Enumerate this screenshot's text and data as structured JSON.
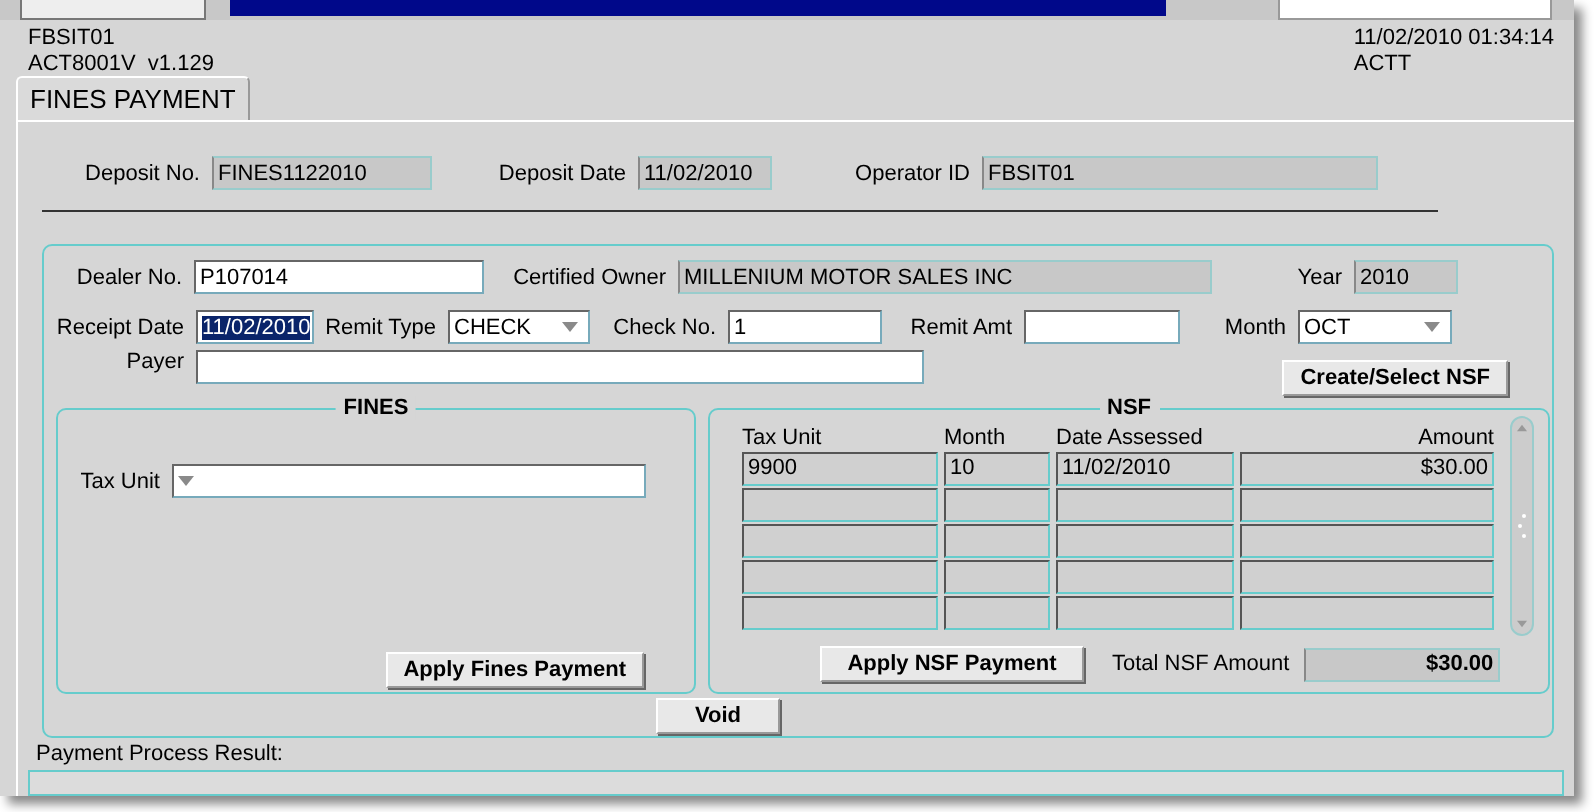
{
  "header": {
    "user": "FBSIT01",
    "version": "ACT8001V  v1.129",
    "datetime": "11/02/2010 01:34:14",
    "region": "ACTT"
  },
  "tabs": [
    {
      "label": "FINES PAYMENT",
      "selected": true
    }
  ],
  "deposit": [
    {
      "label": "Deposit No.",
      "value": "FINES1122010",
      "kind": "readonly"
    },
    {
      "label": "Deposit Date",
      "value": "11/02/2010",
      "kind": "readonly"
    },
    {
      "label": "Operator ID",
      "value": "FBSIT01",
      "kind": "readonly"
    }
  ],
  "form_rows": [
    [
      {
        "label": "Dealer No.",
        "value": "P107014",
        "kind": "text"
      },
      {
        "label": "Certified Owner",
        "value": "MILLENIUM MOTOR SALES INC",
        "kind": "readonly"
      },
      {
        "label": "Year",
        "value": "2010",
        "kind": "readonly"
      }
    ],
    [
      {
        "label": "Receipt Date",
        "value": "11/02/2010",
        "kind": "text",
        "selected": true
      },
      {
        "label": "Remit Type",
        "value": "CHECK",
        "kind": "select"
      },
      {
        "label": "Check No.",
        "value": "1",
        "kind": "text"
      },
      {
        "label": "Remit Amt",
        "kind": "text"
      },
      {
        "label": "Month",
        "value": "OCT",
        "kind": "select"
      }
    ],
    [
      {
        "label": "Payer",
        "kind": "text"
      }
    ]
  ],
  "create_nsf_button": "Create/Select NSF",
  "fines": {
    "title": "FINES",
    "tax_unit": {
      "label": "Tax Unit",
      "kind": "select"
    },
    "button": "Apply Fines Payment"
  },
  "nsf": {
    "title": "NSF",
    "columns": [
      "Tax Unit",
      "Month",
      "Date Assessed",
      "Amount"
    ],
    "rows": [
      [
        "9900",
        "10",
        "11/02/2010",
        "$30.00"
      ]
    ],
    "button": "Apply NSF Payment",
    "total_label": "Total NSF Amount",
    "total_value": "$30.00"
  },
  "void_button": "Void",
  "result": {
    "label": "Payment Process Result:"
  }
}
